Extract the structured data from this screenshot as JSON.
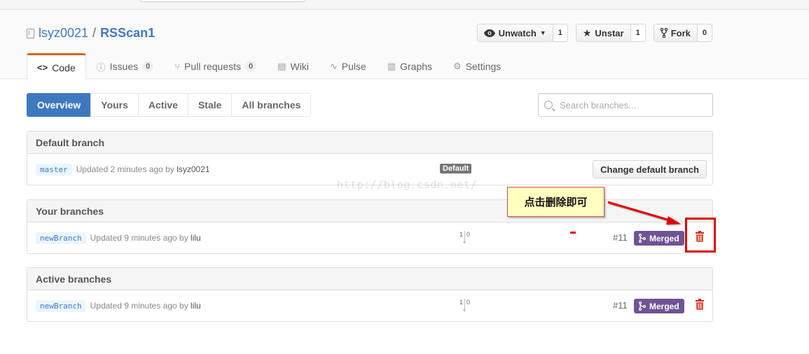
{
  "repo": {
    "owner": "lsyz0021",
    "separator": "/",
    "name": "RSScan1",
    "icon": "repo-icon"
  },
  "actions": {
    "watch": {
      "label": "Unwatch",
      "icon": "eye-icon",
      "count": "1"
    },
    "star": {
      "label": "Unstar",
      "icon": "star-icon",
      "count": "1"
    },
    "fork": {
      "label": "Fork",
      "icon": "fork-icon",
      "count": "0"
    }
  },
  "tabs": [
    {
      "label": "Code",
      "icon": "code-icon",
      "glyph": "<>",
      "counter": ""
    },
    {
      "label": "Issues",
      "icon": "issue-icon",
      "glyph": "ⓘ",
      "counter": "0"
    },
    {
      "label": "Pull requests",
      "icon": "pull-request-icon",
      "glyph": "⑂",
      "counter": "0"
    },
    {
      "label": "Wiki",
      "icon": "book-icon",
      "glyph": "▤",
      "counter": ""
    },
    {
      "label": "Pulse",
      "icon": "pulse-icon",
      "glyph": "∿",
      "counter": ""
    },
    {
      "label": "Graphs",
      "icon": "graph-icon",
      "glyph": "▥",
      "counter": ""
    },
    {
      "label": "Settings",
      "icon": "gear-icon",
      "glyph": "⚙",
      "counter": ""
    }
  ],
  "subnav": [
    "Overview",
    "Yours",
    "Active",
    "Stale",
    "All branches"
  ],
  "search": {
    "placeholder": "Search branches..."
  },
  "sections": {
    "default": {
      "title": "Default branch",
      "branch": "master",
      "updated": "Updated 2 minutes ago by",
      "user": "lsyz0021",
      "label": "Default",
      "button": "Change default branch"
    },
    "yours": {
      "title": "Your branches",
      "branch": "newBranch",
      "updated": "Updated 9 minutes ago by",
      "user": "lilu",
      "behind": "1",
      "ahead": "0",
      "pr": "#11",
      "status": "Merged"
    },
    "active": {
      "title": "Active branches",
      "branch": "newBranch",
      "updated": "Updated 9 minutes ago by",
      "user": "lilu",
      "behind": "1",
      "ahead": "0",
      "pr": "#11",
      "status": "Merged"
    }
  },
  "annotation": {
    "callout": "点击删除即可",
    "watermark": "http://blog.csdn.net/",
    "color": "#e00000"
  },
  "colors": {
    "accent": "#4078c0",
    "merged": "#6e5494",
    "tab_highlight": "#d26911",
    "delete": "#cb2431"
  }
}
